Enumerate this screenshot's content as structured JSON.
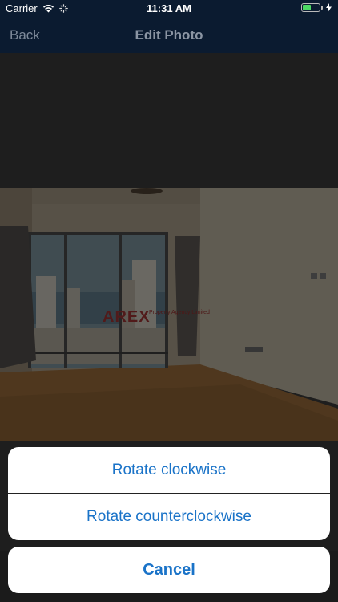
{
  "status_bar": {
    "carrier": "Carrier",
    "time": "11:31 AM",
    "battery_level": 0.5,
    "battery_color": "#4cd964"
  },
  "nav": {
    "back_label": "Back",
    "title": "Edit Photo"
  },
  "photo": {
    "watermark": "AREX",
    "watermark_sub": "Property Agency Limited"
  },
  "action_sheet": {
    "options": [
      {
        "label": "Rotate clockwise"
      },
      {
        "label": "Rotate counterclockwise"
      }
    ],
    "cancel_label": "Cancel",
    "accent_color": "#1a73c8"
  }
}
